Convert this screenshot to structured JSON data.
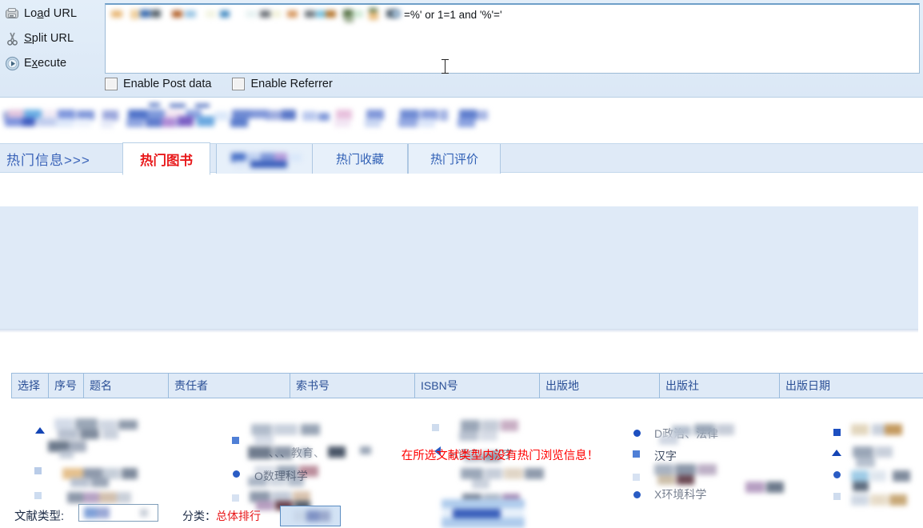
{
  "hackbar": {
    "actions": [
      {
        "icon": "load-url-icon",
        "label_pre": "Lo",
        "label_key": "a",
        "label_post": "d URL",
        "name": "load-url"
      },
      {
        "icon": "scissors-icon",
        "label_pre": "",
        "label_key": "S",
        "label_post": "plit URL",
        "name": "split-url"
      },
      {
        "icon": "play-icon",
        "label_pre": "E",
        "label_key": "x",
        "label_post": "ecute",
        "name": "execute"
      }
    ],
    "url_visible_tail": "=%' or 1=1 and '%'='",
    "checkboxes": [
      {
        "label": "Enable Post data",
        "checked": false,
        "name": "enable-post-data"
      },
      {
        "label": "Enable Referrer",
        "checked": false,
        "name": "enable-referrer"
      }
    ]
  },
  "tabs": {
    "lead_label": "热门信息>>>",
    "items": [
      {
        "label": "热门图书",
        "active": true,
        "blurred": false
      },
      {
        "label": "",
        "active": false,
        "blurred": true
      },
      {
        "label": "热门收藏",
        "active": false,
        "blurred": false
      },
      {
        "label": "热门评价",
        "active": false,
        "blurred": false
      }
    ]
  },
  "category_panel": {
    "visible_labels": [
      "H语言、文字",
      "D政治、法律",
      "汉字",
      "X环境科学",
      "O数理科学",
      "、、、教育、"
    ],
    "doc_type_label": "文献类型:",
    "doc_type_value": "",
    "rank_label_pre": "分类：",
    "rank_label_red": "总体排行",
    "submit_label": ""
  },
  "results_table": {
    "columns": [
      "选择",
      "序号",
      "题名",
      "责任者",
      "索书号",
      "ISBN号",
      "出版地",
      "出版社",
      "出版日期"
    ]
  },
  "empty_message": "在所选文献类型内没有热门浏览信息！",
  "colors": {
    "panel_blue": "#dfeaf7",
    "toolbar_blue": "#dbe8f6",
    "link_blue": "#2f5fb5",
    "alert_red": "#ff0000",
    "active_tab_red": "#e8191b"
  }
}
